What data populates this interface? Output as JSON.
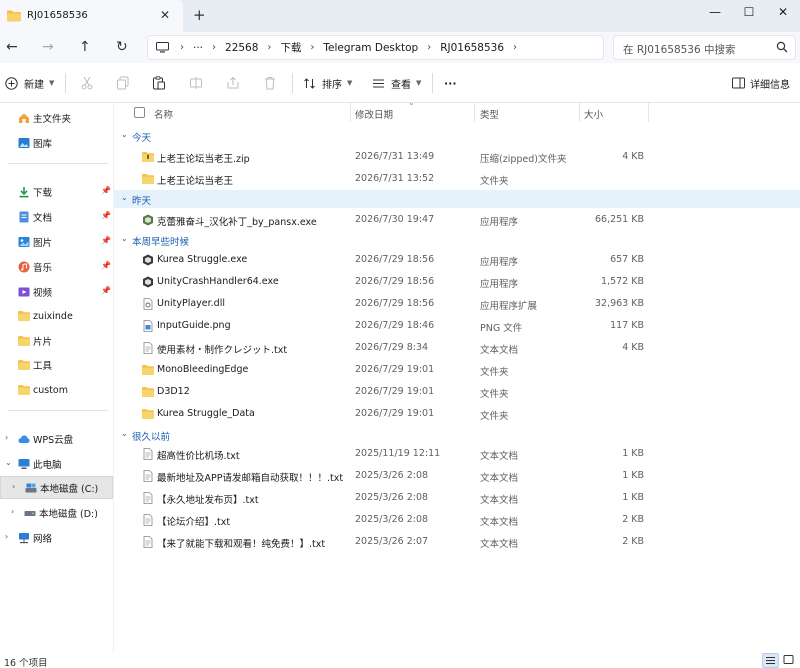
{
  "tab": {
    "title": "RJ01658536",
    "close": "✕",
    "new_tab": "+"
  },
  "window": {
    "minimize": "—",
    "maximize": "☐",
    "close": "✕"
  },
  "address": {
    "overflow": "···",
    "crumbs": [
      "22568",
      "下载",
      "Telegram Desktop",
      "RJ01658536"
    ],
    "sep": "›"
  },
  "search": {
    "placeholder": "在 RJ01658536 中搜索"
  },
  "toolbar": {
    "new_label": "新建",
    "sort_label": "排序",
    "view_label": "查看",
    "more_label": "···",
    "details_label": "详细信息"
  },
  "sidebar": {
    "items": [
      {
        "label": "主文件夹",
        "icon": "home-icon",
        "pinned": false
      },
      {
        "label": "图库",
        "icon": "gallery-icon",
        "pinned": false
      },
      {
        "label": "下载",
        "icon": "download-icon",
        "pinned": true
      },
      {
        "label": "文档",
        "icon": "document-icon",
        "pinned": true
      },
      {
        "label": "图片",
        "icon": "picture-icon",
        "pinned": true
      },
      {
        "label": "音乐",
        "icon": "music-icon",
        "pinned": true
      },
      {
        "label": "视频",
        "icon": "video-icon",
        "pinned": true
      },
      {
        "label": "zuixinde",
        "icon": "folder-icon",
        "pinned": false
      },
      {
        "label": "片片",
        "icon": "folder-icon",
        "pinned": false
      },
      {
        "label": "工具",
        "icon": "folder-icon",
        "pinned": false
      },
      {
        "label": "custom",
        "icon": "folder-icon",
        "pinned": false
      },
      {
        "label": "WPS云盘",
        "icon": "cloud-icon",
        "pinned": false
      },
      {
        "label": "此电脑",
        "icon": "computer-icon",
        "pinned": false
      },
      {
        "label": "本地磁盘 (C:)",
        "icon": "drive-icon",
        "pinned": false
      },
      {
        "label": "本地磁盘 (D:)",
        "icon": "drive-icon",
        "pinned": false
      },
      {
        "label": "网络",
        "icon": "network-icon",
        "pinned": false
      }
    ]
  },
  "columns": {
    "name": "名称",
    "date": "修改日期",
    "type": "类型",
    "size": "大小"
  },
  "groups": [
    {
      "label": "今天",
      "files": [
        {
          "name": "上老王论坛当老王.zip",
          "date": "2026/7/31 13:49",
          "type": "压缩(zipped)文件夹",
          "size": "4 KB",
          "icon": "zip-folder-icon"
        },
        {
          "name": "上老王论坛当老王",
          "date": "2026/7/31 13:52",
          "type": "文件夹",
          "size": "",
          "icon": "folder-icon"
        }
      ]
    },
    {
      "label": "昨天",
      "files": [
        {
          "name": "克蕾雅奋斗_汉化补丁_by_pansx.exe",
          "date": "2026/7/30 19:47",
          "type": "应用程序",
          "size": "66,251 KB",
          "icon": "app-icon"
        }
      ]
    },
    {
      "label": "本周早些时候",
      "files": [
        {
          "name": "Kurea Struggle.exe",
          "date": "2026/7/29 18:56",
          "type": "应用程序",
          "size": "657 KB",
          "icon": "unity-app-icon"
        },
        {
          "name": "UnityCrashHandler64.exe",
          "date": "2026/7/29 18:56",
          "type": "应用程序",
          "size": "1,572 KB",
          "icon": "unity-app-icon"
        },
        {
          "name": "UnityPlayer.dll",
          "date": "2026/7/29 18:56",
          "type": "应用程序扩展",
          "size": "32,963 KB",
          "icon": "dll-icon"
        },
        {
          "name": "InputGuide.png",
          "date": "2026/7/29 18:46",
          "type": "PNG 文件",
          "size": "117 KB",
          "icon": "image-file-icon"
        },
        {
          "name": "使用素材・制作クレジット.txt",
          "date": "2026/7/29 8:34",
          "type": "文本文档",
          "size": "4 KB",
          "icon": "text-file-icon"
        },
        {
          "name": "MonoBleedingEdge",
          "date": "2026/7/29 19:01",
          "type": "文件夹",
          "size": "",
          "icon": "folder-icon"
        },
        {
          "name": "D3D12",
          "date": "2026/7/29 19:01",
          "type": "文件夹",
          "size": "",
          "icon": "folder-icon"
        },
        {
          "name": "Kurea Struggle_Data",
          "date": "2026/7/29 19:01",
          "type": "文件夹",
          "size": "",
          "icon": "folder-icon"
        }
      ]
    },
    {
      "label": "很久以前",
      "files": [
        {
          "name": "超高性价比机场.txt",
          "date": "2025/11/19 12:11",
          "type": "文本文档",
          "size": "1 KB",
          "icon": "text-file-icon"
        },
        {
          "name": "最新地址及APP请发邮箱自动获取！！！.txt",
          "date": "2025/3/26 2:08",
          "type": "文本文档",
          "size": "1 KB",
          "icon": "text-file-icon"
        },
        {
          "name": "【永久地址发布页】.txt",
          "date": "2025/3/26 2:08",
          "type": "文本文档",
          "size": "1 KB",
          "icon": "text-file-icon"
        },
        {
          "name": "【论坛介绍】.txt",
          "date": "2025/3/26 2:08",
          "type": "文本文档",
          "size": "2 KB",
          "icon": "text-file-icon"
        },
        {
          "name": "【来了就能下载和观看！纯免费！】.txt",
          "date": "2025/3/26 2:07",
          "type": "文本文档",
          "size": "2 KB",
          "icon": "text-file-icon"
        }
      ]
    }
  ],
  "status": {
    "count": "16 个项目"
  },
  "colors": {
    "accent": "#1a5fb4",
    "selection": "#e5f1fb",
    "folder": "#f4c24a"
  }
}
